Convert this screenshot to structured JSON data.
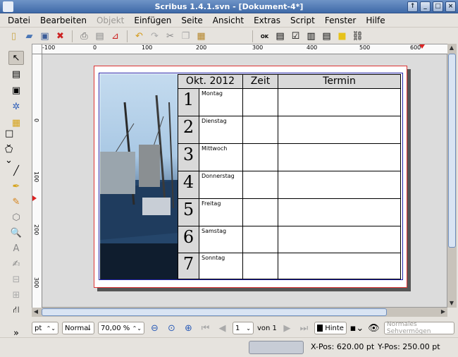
{
  "window": {
    "title": "Scribus 1.4.1.svn - [Dokument-4*]"
  },
  "menubar": [
    "Datei",
    "Bearbeiten",
    "Objekt",
    "Einfügen",
    "Seite",
    "Ansicht",
    "Extras",
    "Script",
    "Fenster",
    "Hilfe"
  ],
  "ruler": {
    "h_labels": [
      "-100",
      "0",
      "100",
      "200",
      "300",
      "400",
      "500",
      "600"
    ],
    "v_labels": [
      "0",
      "100",
      "200",
      "300"
    ]
  },
  "calendar": {
    "header": {
      "month": "Okt. 2012",
      "time": "Zeit",
      "appointment": "Termin"
    },
    "rows": [
      {
        "num": "1",
        "day": "Montag"
      },
      {
        "num": "2",
        "day": "Dienstag"
      },
      {
        "num": "3",
        "day": "Mittwoch"
      },
      {
        "num": "4",
        "day": "Donnerstag"
      },
      {
        "num": "5",
        "day": "Freitag"
      },
      {
        "num": "6",
        "day": "Samstag"
      },
      {
        "num": "7",
        "day": "Sonntag"
      }
    ]
  },
  "bottombar": {
    "unit": "pt",
    "mode": "Normal",
    "zoom": "70,00 %",
    "page_num": "1",
    "page_of": "von 1",
    "layer": "Hinte",
    "view_mode": "Normales Sehvermögen"
  },
  "status": {
    "xpos": "X-Pos:  620.00 pt",
    "ypos": "Y-Pos:  250.00 pt"
  }
}
